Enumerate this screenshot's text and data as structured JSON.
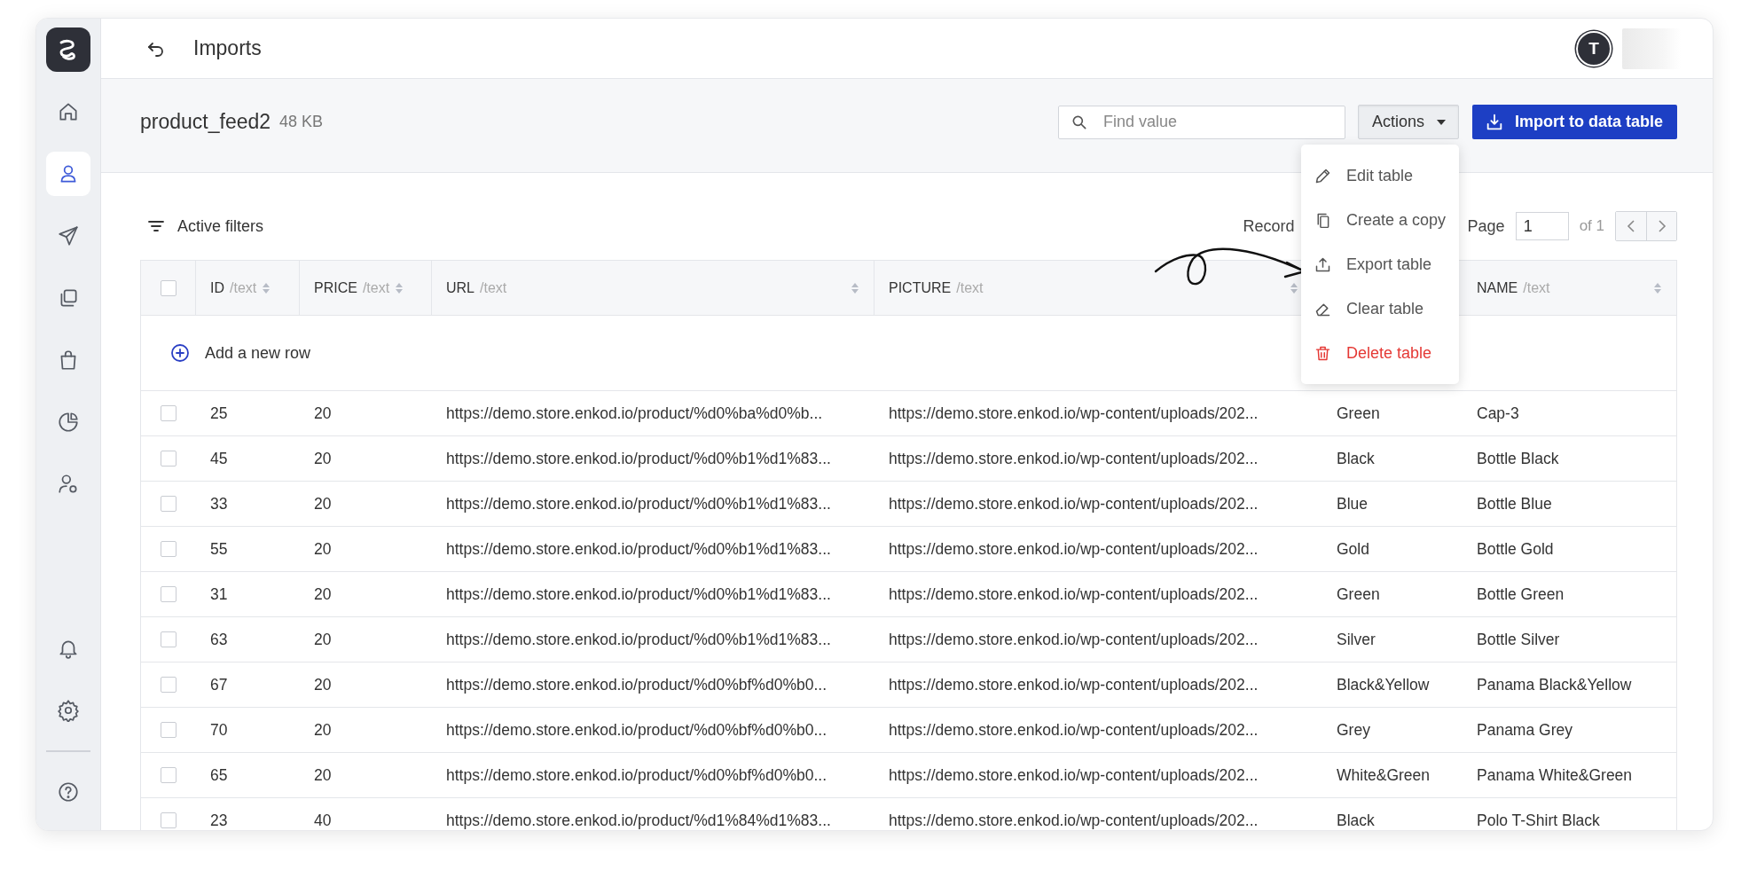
{
  "sidebar": {
    "items": [
      {
        "kind": "home",
        "selected": false
      },
      {
        "kind": "person",
        "selected": true
      },
      {
        "kind": "send",
        "selected": false
      },
      {
        "kind": "copies",
        "selected": false
      },
      {
        "kind": "bag",
        "selected": false
      },
      {
        "kind": "pie",
        "selected": false
      },
      {
        "kind": "person-gear",
        "selected": false
      }
    ],
    "bottom_items": [
      {
        "kind": "bell",
        "selected": false
      },
      {
        "kind": "gear",
        "selected": false
      }
    ],
    "help": {
      "kind": "help",
      "selected": false
    }
  },
  "header": {
    "title": "Imports",
    "avatar": "T"
  },
  "file": {
    "name": "product_feed2",
    "size": "48 KB"
  },
  "search": {
    "placeholder": "Find value"
  },
  "actions": {
    "label": "Actions",
    "expanded": true,
    "menu": [
      {
        "label": "Edit table",
        "kind": "edit",
        "danger": false
      },
      {
        "label": "Create a copy",
        "kind": "copy",
        "danger": false
      },
      {
        "label": "Export table",
        "kind": "export",
        "danger": false
      },
      {
        "label": "Clear table",
        "kind": "clear",
        "danger": false
      },
      {
        "label": "Delete table",
        "kind": "delete",
        "danger": true
      }
    ]
  },
  "import_button": "Import to data table",
  "filters": "Active filters",
  "pagination": {
    "records_label": "Record",
    "page_label": "Page",
    "page": "1",
    "total": "of 1"
  },
  "table": {
    "select_all": {
      "checked": false
    },
    "columns": [
      {
        "name": "ID",
        "type": "/text",
        "sortable": true
      },
      {
        "name": "PRICE",
        "type": "/text",
        "sortable": true
      },
      {
        "name": "URL",
        "type": "/text",
        "sortable": true
      },
      {
        "name": "PICTURE",
        "type": "/text",
        "sortable": true
      },
      {
        "sortable": false
      },
      {
        "name": "NAME",
        "type": "/text",
        "sortable": true
      }
    ],
    "add_row": "Add a new row",
    "rows": [
      {
        "checked": false,
        "cells": [
          "25",
          "20",
          "https://demo.store.enkod.io/product/%d0%ba%d0%b...",
          "https://demo.store.enkod.io/wp-content/uploads/202...",
          "Green",
          "Cap-3"
        ]
      },
      {
        "checked": false,
        "cells": [
          "45",
          "20",
          "https://demo.store.enkod.io/product/%d0%b1%d1%83...",
          "https://demo.store.enkod.io/wp-content/uploads/202...",
          "Black",
          "Bottle Black"
        ]
      },
      {
        "checked": false,
        "cells": [
          "33",
          "20",
          "https://demo.store.enkod.io/product/%d0%b1%d1%83...",
          "https://demo.store.enkod.io/wp-content/uploads/202...",
          "Blue",
          "Bottle Blue"
        ]
      },
      {
        "checked": false,
        "cells": [
          "55",
          "20",
          "https://demo.store.enkod.io/product/%d0%b1%d1%83...",
          "https://demo.store.enkod.io/wp-content/uploads/202...",
          "Gold",
          "Bottle Gold"
        ]
      },
      {
        "checked": false,
        "cells": [
          "31",
          "20",
          "https://demo.store.enkod.io/product/%d0%b1%d1%83...",
          "https://demo.store.enkod.io/wp-content/uploads/202...",
          "Green",
          "Bottle Green"
        ]
      },
      {
        "checked": false,
        "cells": [
          "63",
          "20",
          "https://demo.store.enkod.io/product/%d0%b1%d1%83...",
          "https://demo.store.enkod.io/wp-content/uploads/202...",
          "Silver",
          "Bottle Silver"
        ]
      },
      {
        "checked": false,
        "cells": [
          "67",
          "20",
          "https://demo.store.enkod.io/product/%d0%bf%d0%b0...",
          "https://demo.store.enkod.io/wp-content/uploads/202...",
          "Black&Yellow",
          "Panama Black&Yellow"
        ]
      },
      {
        "checked": false,
        "cells": [
          "70",
          "20",
          "https://demo.store.enkod.io/product/%d0%bf%d0%b0...",
          "https://demo.store.enkod.io/wp-content/uploads/202...",
          "Grey",
          "Panama Grey"
        ]
      },
      {
        "checked": false,
        "cells": [
          "65",
          "20",
          "https://demo.store.enkod.io/product/%d0%bf%d0%b0...",
          "https://demo.store.enkod.io/wp-content/uploads/202...",
          "White&Green",
          "Panama White&Green"
        ]
      },
      {
        "checked": false,
        "cells": [
          "23",
          "40",
          "https://demo.store.enkod.io/product/%d1%84%d1%83...",
          "https://demo.store.enkod.io/wp-content/uploads/202...",
          "Black",
          "Polo T-Shirt Black"
        ]
      }
    ]
  }
}
